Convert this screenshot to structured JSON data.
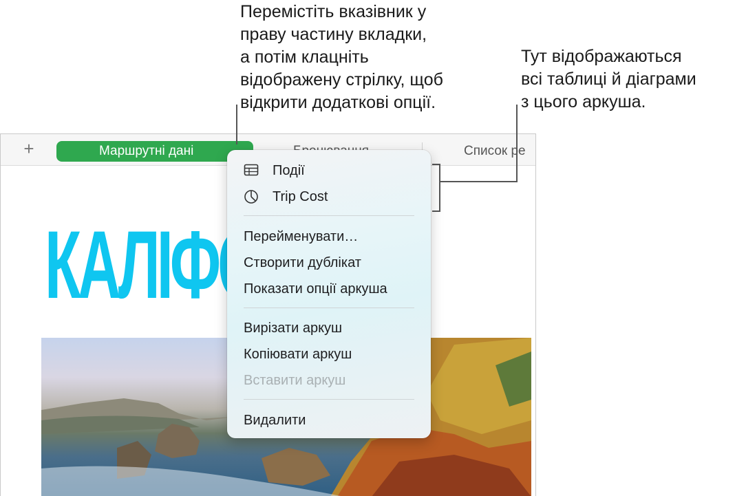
{
  "callouts": {
    "left": [
      "Перемістіть вказівник у",
      "праву частину вкладки,",
      "а потім клацніть",
      "відображену стрілку, щоб",
      "відкрити додаткові опції."
    ],
    "right": [
      "Тут відображаються",
      "всі таблиці й діаграми",
      "з цього аркуша."
    ]
  },
  "tabbar": {
    "add_symbol": "+",
    "active_tab": {
      "label": "Маршрутні дані",
      "arrow": "⌄"
    },
    "tabs": [
      "Бронювання",
      "Список ре"
    ]
  },
  "sheet": {
    "title": "КАЛІФО"
  },
  "menu": {
    "objects": [
      {
        "label": "Події",
        "icon": "table-icon"
      },
      {
        "label": "Trip Cost",
        "icon": "pie-chart-icon"
      }
    ],
    "actions": [
      "Перейменувати…",
      "Створити дублікат",
      "Показати опції аркуша"
    ],
    "clipboard": [
      {
        "label": "Вирізати аркуш",
        "enabled": true
      },
      {
        "label": "Копіювати аркуш",
        "enabled": true
      },
      {
        "label": "Вставити аркуш",
        "enabled": false
      }
    ],
    "delete_label": "Видалити"
  },
  "colors": {
    "active_tab": "#2fa84f",
    "title": "#0fc6f0"
  }
}
